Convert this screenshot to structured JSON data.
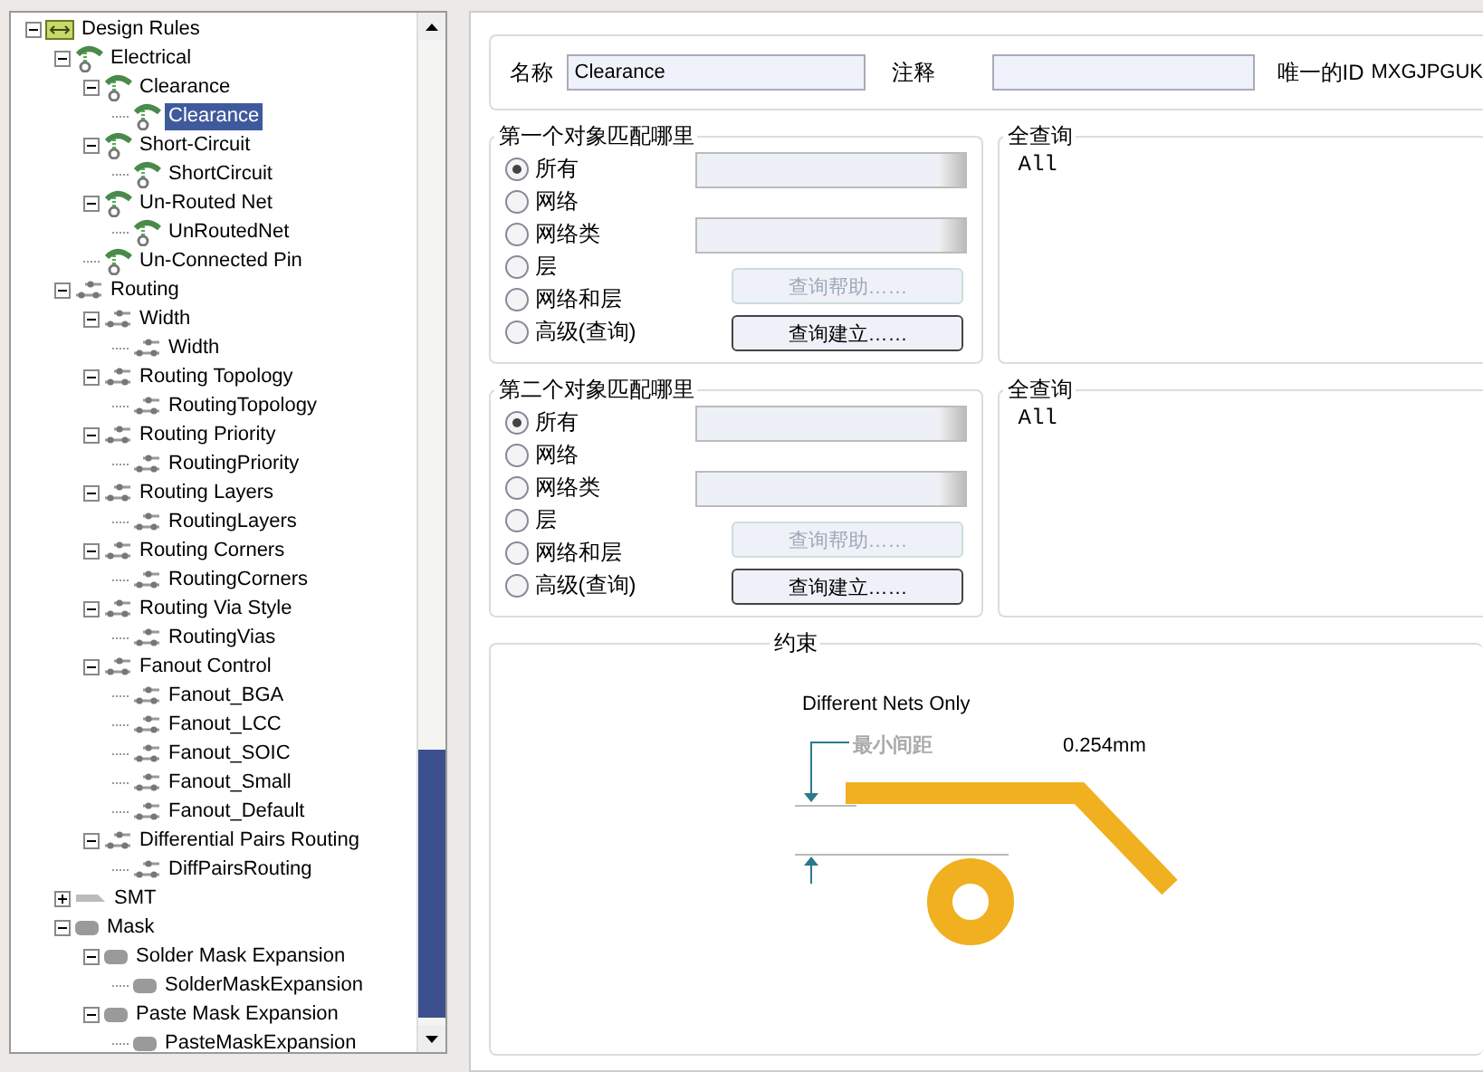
{
  "tree": [
    {
      "label": "Design Rules",
      "kind": "folder",
      "expanded": true,
      "selected": false,
      "children": [
        {
          "label": "Electrical",
          "kind": "electrical",
          "expanded": true,
          "selected": false,
          "children": [
            {
              "label": "Clearance",
              "kind": "electrical",
              "expanded": true,
              "selected": false,
              "children": [
                {
                  "label": "Clearance",
                  "kind": "electrical",
                  "selected": true
                }
              ]
            },
            {
              "label": "Short-Circuit",
              "kind": "electrical",
              "expanded": true,
              "selected": false,
              "children": [
                {
                  "label": "ShortCircuit",
                  "kind": "electrical",
                  "selected": false
                }
              ]
            },
            {
              "label": "Un-Routed Net",
              "kind": "electrical",
              "expanded": true,
              "selected": false,
              "children": [
                {
                  "label": "UnRoutedNet",
                  "kind": "electrical",
                  "selected": false
                }
              ]
            },
            {
              "label": "Un-Connected Pin",
              "kind": "electrical",
              "selected": false
            }
          ]
        },
        {
          "label": "Routing",
          "kind": "routing",
          "expanded": true,
          "selected": false,
          "children": [
            {
              "label": "Width",
              "kind": "routing",
              "expanded": true,
              "selected": false,
              "children": [
                {
                  "label": "Width",
                  "kind": "routing",
                  "selected": false
                }
              ]
            },
            {
              "label": "Routing Topology",
              "kind": "routing",
              "expanded": true,
              "selected": false,
              "children": [
                {
                  "label": "RoutingTopology",
                  "kind": "routing",
                  "selected": false
                }
              ]
            },
            {
              "label": "Routing Priority",
              "kind": "routing",
              "expanded": true,
              "selected": false,
              "children": [
                {
                  "label": "RoutingPriority",
                  "kind": "routing",
                  "selected": false
                }
              ]
            },
            {
              "label": "Routing Layers",
              "kind": "routing",
              "expanded": true,
              "selected": false,
              "children": [
                {
                  "label": "RoutingLayers",
                  "kind": "routing",
                  "selected": false
                }
              ]
            },
            {
              "label": "Routing Corners",
              "kind": "routing",
              "expanded": true,
              "selected": false,
              "children": [
                {
                  "label": "RoutingCorners",
                  "kind": "routing",
                  "selected": false
                }
              ]
            },
            {
              "label": "Routing Via Style",
              "kind": "routing",
              "expanded": true,
              "selected": false,
              "children": [
                {
                  "label": "RoutingVias",
                  "kind": "routing",
                  "selected": false
                }
              ]
            },
            {
              "label": "Fanout Control",
              "kind": "routing",
              "expanded": true,
              "selected": false,
              "children": [
                {
                  "label": "Fanout_BGA",
                  "kind": "routing",
                  "selected": false
                },
                {
                  "label": "Fanout_LCC",
                  "kind": "routing",
                  "selected": false
                },
                {
                  "label": "Fanout_SOIC",
                  "kind": "routing",
                  "selected": false
                },
                {
                  "label": "Fanout_Small",
                  "kind": "routing",
                  "selected": false
                },
                {
                  "label": "Fanout_Default",
                  "kind": "routing",
                  "selected": false
                }
              ]
            },
            {
              "label": "Differential Pairs Routing",
              "kind": "routing",
              "expanded": true,
              "selected": false,
              "children": [
                {
                  "label": "DiffPairsRouting",
                  "kind": "routing",
                  "selected": false
                }
              ]
            }
          ]
        },
        {
          "label": "SMT",
          "kind": "smt",
          "expanded": false,
          "selected": false
        },
        {
          "label": "Mask",
          "kind": "mask",
          "expanded": true,
          "selected": false,
          "children": [
            {
              "label": "Solder Mask Expansion",
              "kind": "mask",
              "expanded": true,
              "selected": false,
              "children": [
                {
                  "label": "SolderMaskExpansion",
                  "kind": "mask",
                  "selected": false
                }
              ]
            },
            {
              "label": "Paste Mask Expansion",
              "kind": "mask",
              "expanded": true,
              "selected": false,
              "children": [
                {
                  "label": "PasteMaskExpansion",
                  "kind": "mask",
                  "selected": false
                }
              ]
            }
          ]
        }
      ]
    }
  ],
  "rule": {
    "name_label": "名称",
    "name_value": "Clearance",
    "comment_label": "注释",
    "id_label": "唯一的ID",
    "id_value": "MXGJPGUK"
  },
  "object_matches": [
    {
      "title": "第一个对象匹配哪里",
      "options": [
        {
          "label": "所有",
          "selected": true
        },
        {
          "label": "网络",
          "selected": false
        },
        {
          "label": "网络类",
          "selected": false
        },
        {
          "label": "层",
          "selected": false
        },
        {
          "label": "网络和层",
          "selected": false
        },
        {
          "label": "高级(查询)",
          "selected": false
        }
      ],
      "buttons": [
        {
          "label": "查询帮助……",
          "disabled": true
        },
        {
          "label": "查询建立……",
          "disabled": false
        }
      ],
      "query_title": "全查询",
      "query_text": "All"
    },
    {
      "title": "第二个对象匹配哪里",
      "options": [
        {
          "label": "所有",
          "selected": true
        },
        {
          "label": "网络",
          "selected": false
        },
        {
          "label": "网络类",
          "selected": false
        },
        {
          "label": "层",
          "selected": false
        },
        {
          "label": "网络和层",
          "selected": false
        },
        {
          "label": "高级(查询)",
          "selected": false
        }
      ],
      "buttons": [
        {
          "label": "查询帮助……",
          "disabled": true
        },
        {
          "label": "查询建立……",
          "disabled": false
        }
      ],
      "query_title": "全查询",
      "query_text": "All"
    }
  ],
  "constraints": {
    "title": "约束",
    "mode_label": "Different Nets Only",
    "gap_label": "最小间距",
    "value": "0.254mm"
  }
}
